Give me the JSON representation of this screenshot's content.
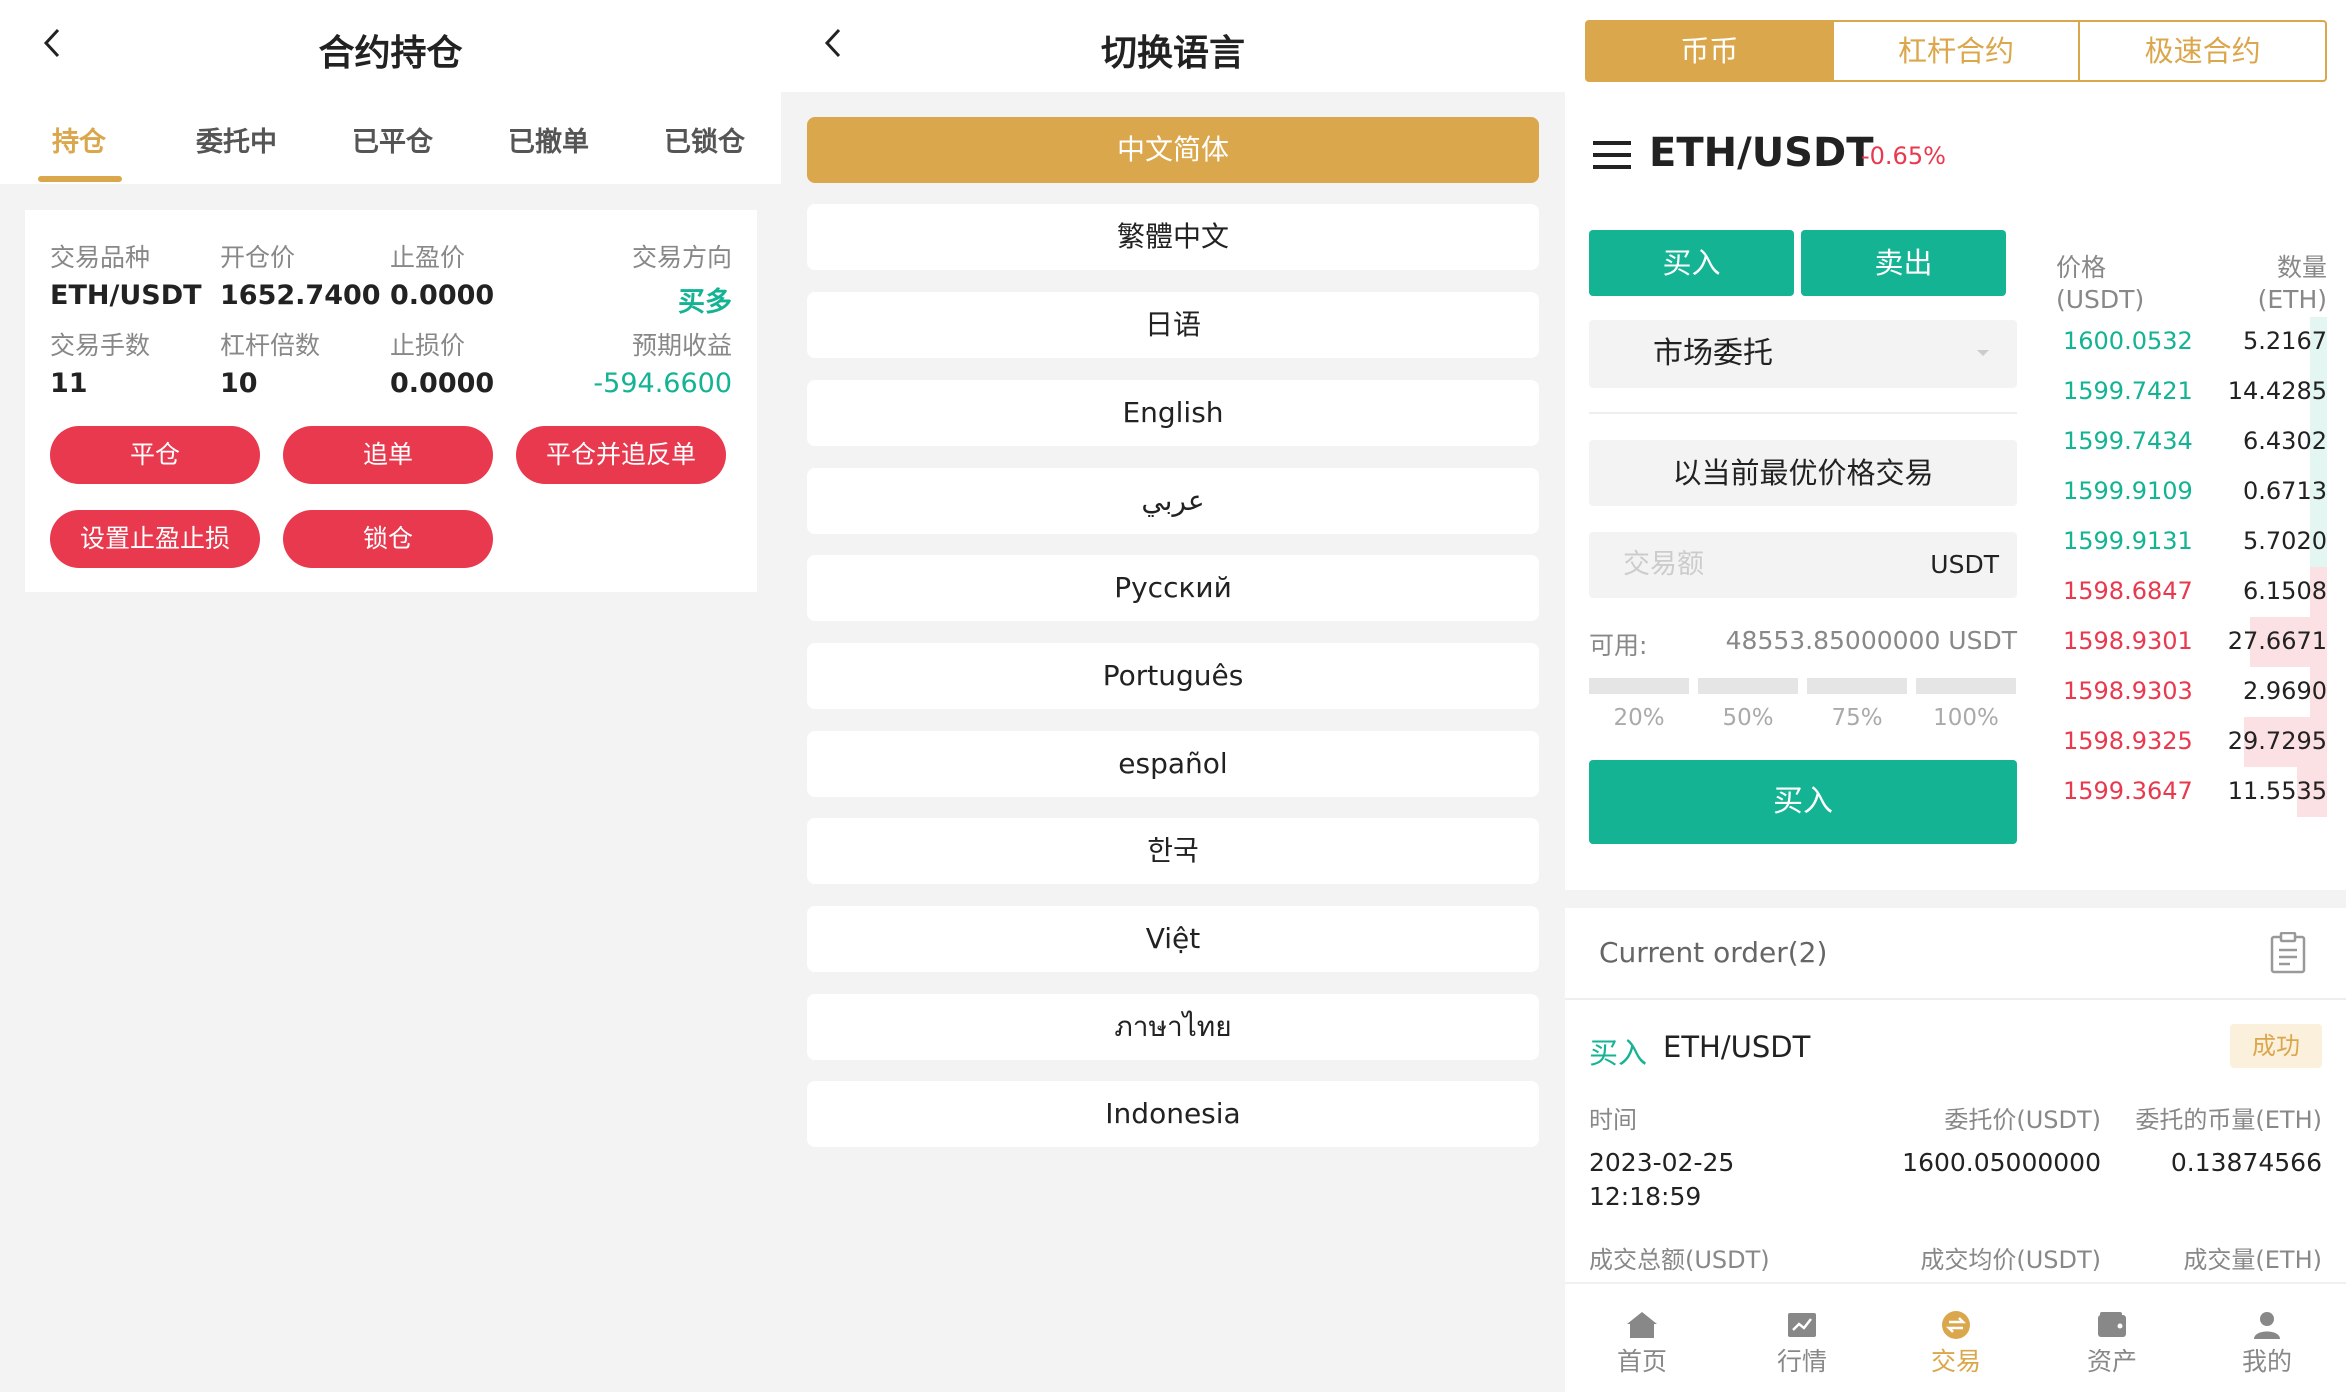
{
  "panel_positions": {
    "title": "合约持仓",
    "tabs": [
      "持仓",
      "委托中",
      "已平仓",
      "已撤单",
      "已锁仓"
    ],
    "card": {
      "symbol_label": "交易品种",
      "symbol": "ETH/USDT",
      "open_price_label": "开仓价",
      "open_price": "1652.7400",
      "take_profit_label": "止盈价",
      "take_profit": "0.0000",
      "direction_label": "交易方向",
      "direction": "买多",
      "lots_label": "交易手数",
      "lots": "11",
      "leverage_label": "杠杆倍数",
      "leverage": "10",
      "stop_loss_label": "止损价",
      "stop_loss": "0.0000",
      "expected_label": "预期收益",
      "expected": "-594.6600"
    },
    "buttons": [
      "平仓",
      "追单",
      "平仓并追反单",
      "设置止盈止损",
      "锁仓"
    ]
  },
  "panel_language": {
    "title": "切换语言",
    "languages": [
      "中文简体",
      "繁體中文",
      "日语",
      "English",
      "عربي",
      "Русский",
      "Português",
      "español",
      "한국",
      "Việt",
      "ภาษาไทย",
      "Indonesia"
    ],
    "selected": "中文简体"
  },
  "panel_trade": {
    "segments": [
      "币币",
      "杠杆合约",
      "极速合约"
    ],
    "pair": "ETH/USDT",
    "change": "-0.65%",
    "buy_tab": "买入",
    "sell_tab": "卖出",
    "order_type": "市场委托",
    "best_price": "以当前最优价格交易",
    "amount_placeholder": "交易额",
    "amount_unit": "USDT",
    "available_label": "可用:",
    "available_value": "48553.85000000 USDT",
    "percents": [
      "20%",
      "50%",
      "75%",
      "100%"
    ],
    "buy_button": "买入",
    "orderbook": {
      "price_header": "价格",
      "price_unit": "(USDT)",
      "qty_header": "数量",
      "qty_unit": "(ETH)",
      "bids": [
        {
          "price": "1600.0532",
          "qty": "5.2167",
          "depth": 0.06
        },
        {
          "price": "1599.7421",
          "qty": "14.4285",
          "depth": 0.06
        },
        {
          "price": "1599.7434",
          "qty": "6.4302",
          "depth": 0.06
        },
        {
          "price": "1599.9109",
          "qty": "0.6713",
          "depth": 0.06
        },
        {
          "price": "1599.9131",
          "qty": "5.7020",
          "depth": 0.06
        }
      ],
      "asks": [
        {
          "price": "1598.6847",
          "qty": "6.1508",
          "depth": 0.06
        },
        {
          "price": "1598.9301",
          "qty": "27.6671",
          "depth": 0.28
        },
        {
          "price": "1598.9303",
          "qty": "2.9690",
          "depth": 0.06
        },
        {
          "price": "1598.9325",
          "qty": "29.7295",
          "depth": 0.3
        },
        {
          "price": "1599.3647",
          "qty": "11.5535",
          "depth": 0.11
        }
      ],
      "bid_color": "#13b393",
      "ask_color": "#e8394e"
    },
    "orders": {
      "title": "Current order(2)",
      "side": "买入",
      "pair": "ETH/USDT",
      "status": "成功",
      "time_label": "时间",
      "price_label": "委托价(USDT)",
      "amount_label": "委托的币量(ETH)",
      "date": "2023-02-25",
      "time": "12:18:59",
      "price": "1600.05000000",
      "amount": "0.13874566",
      "total_label": "成交总额(USDT)",
      "avg_label": "成交均价(USDT)",
      "filled_label": "成交量(ETH)"
    },
    "nav": [
      "首页",
      "行情",
      "交易",
      "资产",
      "我的"
    ],
    "nav_active": "交易"
  },
  "colors": {
    "gold": "#dba74c",
    "green": "#13b393",
    "red": "#e8394e"
  }
}
